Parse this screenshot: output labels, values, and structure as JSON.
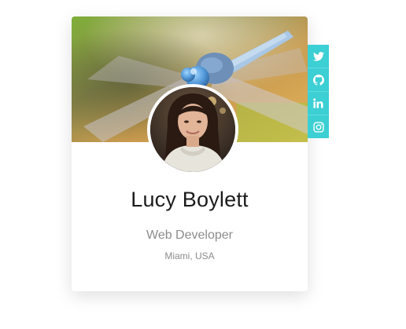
{
  "profile": {
    "name": "Lucy Boylett",
    "title": "Web Developer",
    "location": "Miami, USA"
  },
  "social": [
    {
      "icon": "twitter-icon"
    },
    {
      "icon": "github-icon"
    },
    {
      "icon": "linkedin-icon"
    },
    {
      "icon": "instagram-icon"
    }
  ],
  "colors": {
    "accent": "#3ccfd3",
    "name_text": "#1b1b1b",
    "muted_text": "#8c8c8c",
    "card_bg": "#ffffff"
  }
}
